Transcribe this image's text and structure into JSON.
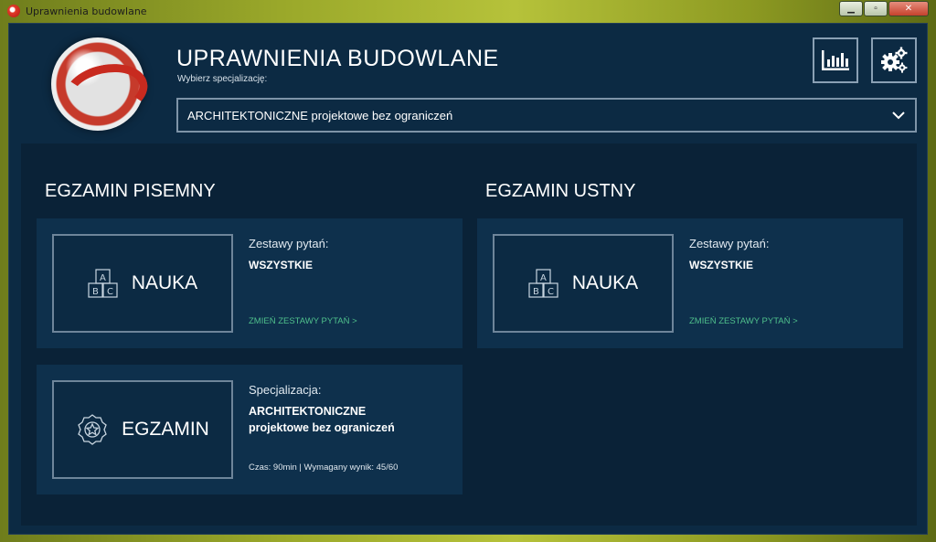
{
  "window": {
    "title": "Uprawnienia budowlane",
    "controls": {
      "minimize": "▁",
      "maximize": "▫",
      "close": "✕"
    }
  },
  "header": {
    "title": "UPRAWNIENIA BUDOWLANE",
    "subtitle": "Wybierz specjalizację:",
    "selected_specialization": "ARCHITEKTONICZNE projektowe bez ograniczeń",
    "icons": {
      "stats": "bar-chart-icon",
      "settings": "gears-icon",
      "dropdown": "chevron-down-icon"
    }
  },
  "written_exam": {
    "title": "EGZAMIN PISEMNY",
    "study_card": {
      "tile_label": "NAUKA",
      "tile_icon": "abc-blocks-icon",
      "sets_label": "Zestawy pytań:",
      "sets_value": "WSZYSTKIE",
      "change_link": "ZMIEŃ ZESTAWY PYTAŃ >"
    },
    "exam_card": {
      "tile_label": "EGZAMIN",
      "tile_icon": "award-badge-icon",
      "spec_label": "Specjalizacja:",
      "spec_line1": "ARCHITEKTONICZNE",
      "spec_line2": "projektowe bez ograniczeń",
      "details": "Czas: 90min | Wymagany wynik: 45/60"
    }
  },
  "oral_exam": {
    "title": "EGZAMIN USTNY",
    "study_card": {
      "tile_label": "NAUKA",
      "tile_icon": "abc-blocks-icon",
      "sets_label": "Zestawy pytań:",
      "sets_value": "WSZYSTKIE",
      "change_link": "ZMIEŃ ZESTAWY PYTAŃ >"
    }
  },
  "colors": {
    "background": "#0c2a43",
    "panel": "#0a2237",
    "card": "#0e304c",
    "link": "#4fc08c",
    "border": "#6e859a"
  }
}
